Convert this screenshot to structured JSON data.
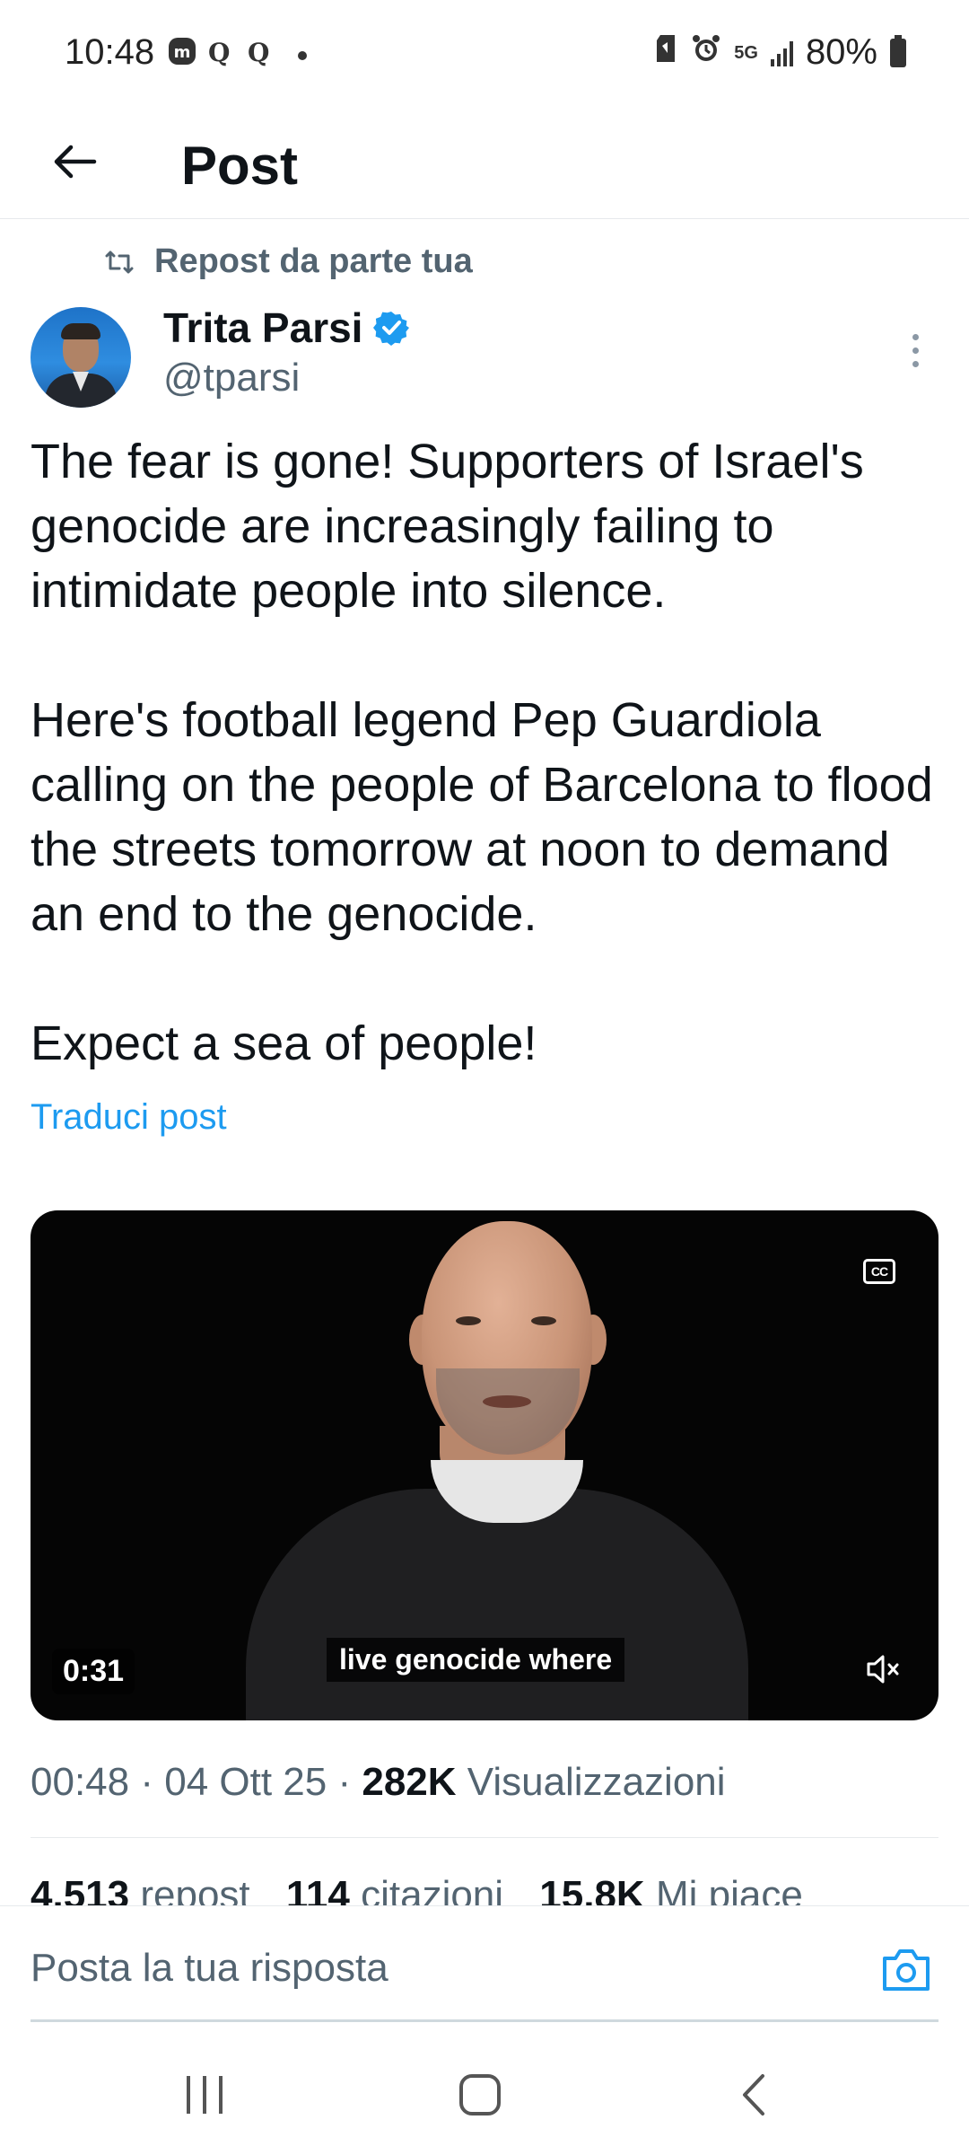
{
  "status_bar": {
    "time": "10:48",
    "network": "5G",
    "battery": "80%"
  },
  "header": {
    "title": "Post"
  },
  "repost": {
    "text": "Repost da parte tua"
  },
  "author": {
    "name": "Trita Parsi",
    "handle": "@tparsi",
    "verified": true
  },
  "post": {
    "paragraphs": [
      "The fear is gone! Supporters of Israel's genocide are increasingly failing to intimidate people into silence.",
      "Here's football legend Pep Guardiola calling on the people of Barcelona to flood the streets tomorrow at noon to demand an end to the genocide.",
      "Expect a sea of people!"
    ],
    "translate_label": "Traduci post"
  },
  "video": {
    "duration": "0:31",
    "subtitle": "live genocide where",
    "cc_label": "CC"
  },
  "meta": {
    "time": "00:48",
    "date": "04 Ott 25",
    "views_count": "282K",
    "views_label": "Visualizzazioni"
  },
  "stats": {
    "reposts_count": "4.513",
    "reposts_label": "repost",
    "quotes_count": "114",
    "quotes_label": "citazioni",
    "likes_count": "15,8K",
    "likes_label": "Mi piace"
  },
  "reply": {
    "placeholder": "Posta la tua risposta"
  },
  "colors": {
    "accent": "#1d9bf0",
    "text_primary": "#0f1419",
    "text_secondary": "#536471"
  }
}
